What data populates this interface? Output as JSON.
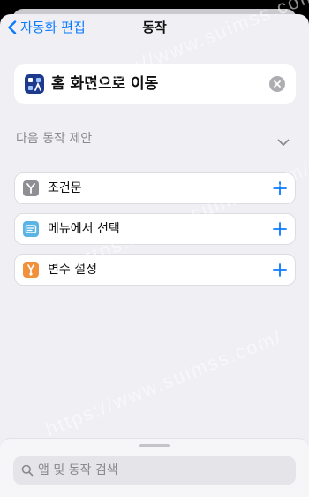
{
  "nav": {
    "back_label": "자동화 편집",
    "title": "동작"
  },
  "action": {
    "label": "홈 화면으로 이동",
    "icon": "home-screen-icon"
  },
  "suggestions": {
    "header": "다음 동작 제안",
    "items": [
      {
        "label": "조건문",
        "icon": "if-branch-icon",
        "color": "#8e8e93"
      },
      {
        "label": "메뉴에서 선택",
        "icon": "menu-list-icon",
        "color": "#5ab4e5"
      },
      {
        "label": "변수 설정",
        "icon": "variable-icon",
        "color": "#f1913b"
      }
    ]
  },
  "search": {
    "placeholder": "앱 및 동작 검색"
  },
  "watermark": "https://www.suimss.com/",
  "colors": {
    "accent": "#0a7aff",
    "background": "#efeff4"
  }
}
